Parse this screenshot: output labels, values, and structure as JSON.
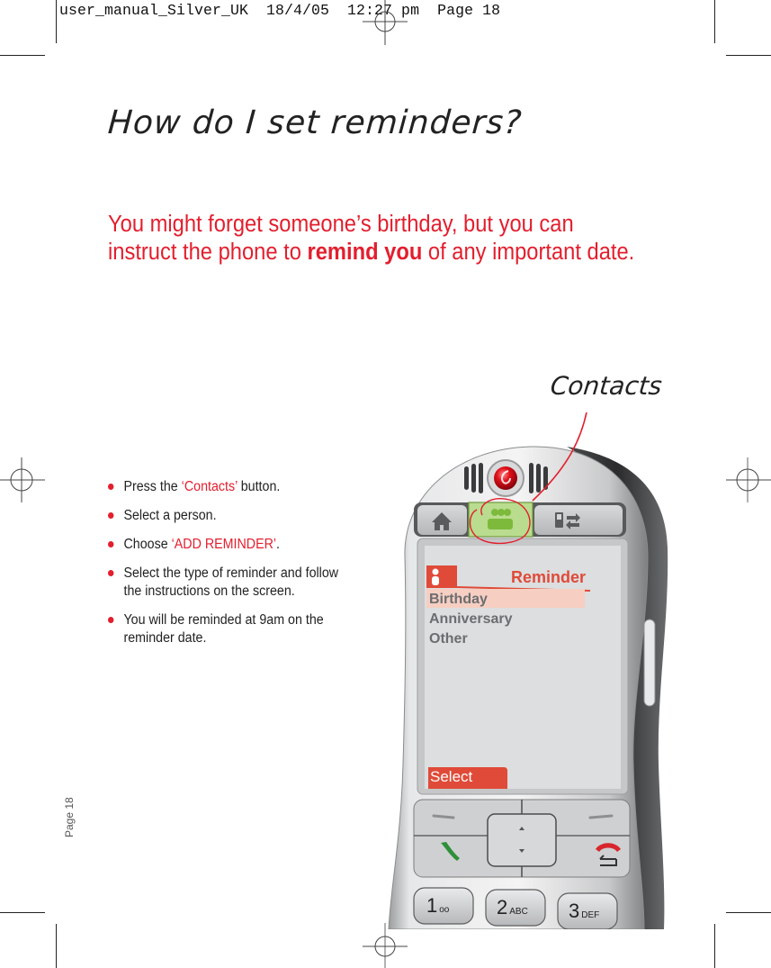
{
  "slug": {
    "text": "user_manual_Silver_UK  18/4/05  12:27 pm  Page 18"
  },
  "title": "How do I set reminders?",
  "intro": {
    "before": "You might forget someone’s birthday, but you can instruct the phone to ",
    "emphasis": "remind you",
    "after": " of any important date."
  },
  "steps": [
    {
      "before": "Press the ",
      "highlight": "‘Contacts’",
      "after": " button."
    },
    {
      "before": "Select a person.",
      "highlight": "",
      "after": ""
    },
    {
      "before": "Choose ",
      "highlight": "‘ADD REMINDER’",
      "after": "."
    },
    {
      "before": "Select the type of reminder and follow the instructions on the screen.",
      "highlight": "",
      "after": ""
    },
    {
      "before": "You will be reminded at 9am on the reminder date.",
      "highlight": "",
      "after": ""
    }
  ],
  "page_label": "Page 18",
  "annotation": {
    "label": "Contacts"
  },
  "phone": {
    "tabs": [
      {
        "icon": "home-icon"
      },
      {
        "icon": "contacts-icon",
        "active": true
      },
      {
        "icon": "phone-transfer-icon"
      }
    ],
    "screen": {
      "header": "Reminder",
      "items": [
        "Birthday",
        "Anniversary",
        "Other"
      ],
      "selected_index": 0,
      "softkey": "Select"
    },
    "keys": [
      {
        "digit": "1",
        "sub": "ᴏᴏ"
      },
      {
        "digit": "2",
        "sub": "ABC"
      },
      {
        "digit": "3",
        "sub": "DEF"
      }
    ]
  },
  "colors": {
    "accent_red": "#e31e2d",
    "screen_red": "#e04a38",
    "highlight_row": "#f6cfc2",
    "active_tab_green": "#a8d27a",
    "text_dark": "#222222"
  }
}
